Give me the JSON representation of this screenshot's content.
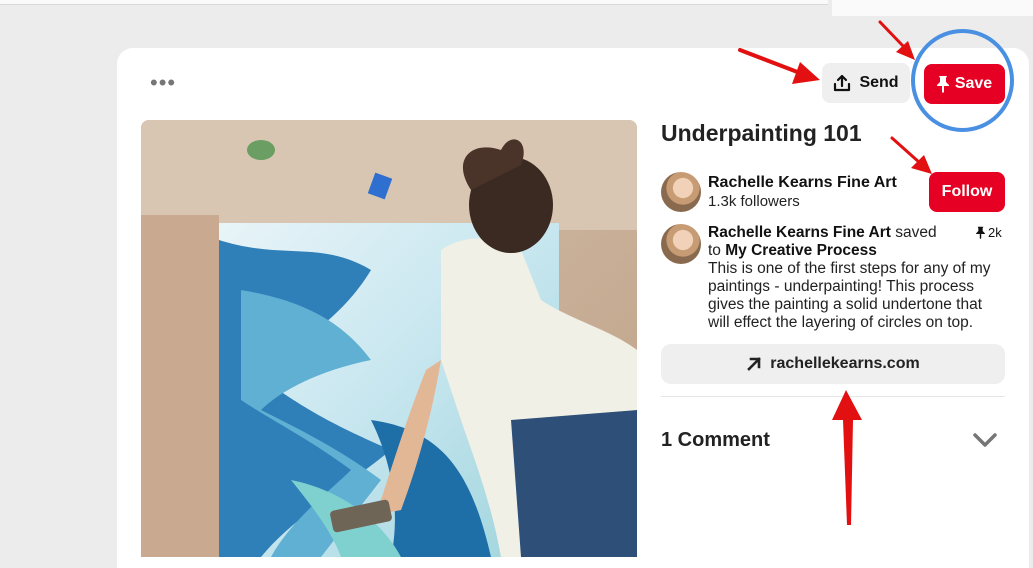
{
  "toolbar": {
    "more_label": "•••",
    "send_label": "Send",
    "save_label": "Save"
  },
  "pin": {
    "title": "Underpainting 101",
    "creator": {
      "name": "Rachelle Kearns Fine Art",
      "followers": "1.3k followers",
      "follow_label": "Follow"
    },
    "saved_by": {
      "name": "Rachelle Kearns Fine Art",
      "action": "saved",
      "to_prefix": "to",
      "board": "My Creative Process",
      "description": "This is one of the first steps for any of my paintings - underpainting! This process gives the painting a solid undertone that will effect the layering of circles on top.",
      "pin_count": "2k"
    },
    "link_label": "rachellekearns.com",
    "comments_label": "1 Comment"
  },
  "colors": {
    "brand_red": "#e60023",
    "highlight_blue": "#4a90e2",
    "button_gray": "#efefef"
  },
  "icons": [
    "more-icon",
    "share-icon",
    "pin-icon",
    "external-link-icon",
    "chevron-down-icon"
  ]
}
